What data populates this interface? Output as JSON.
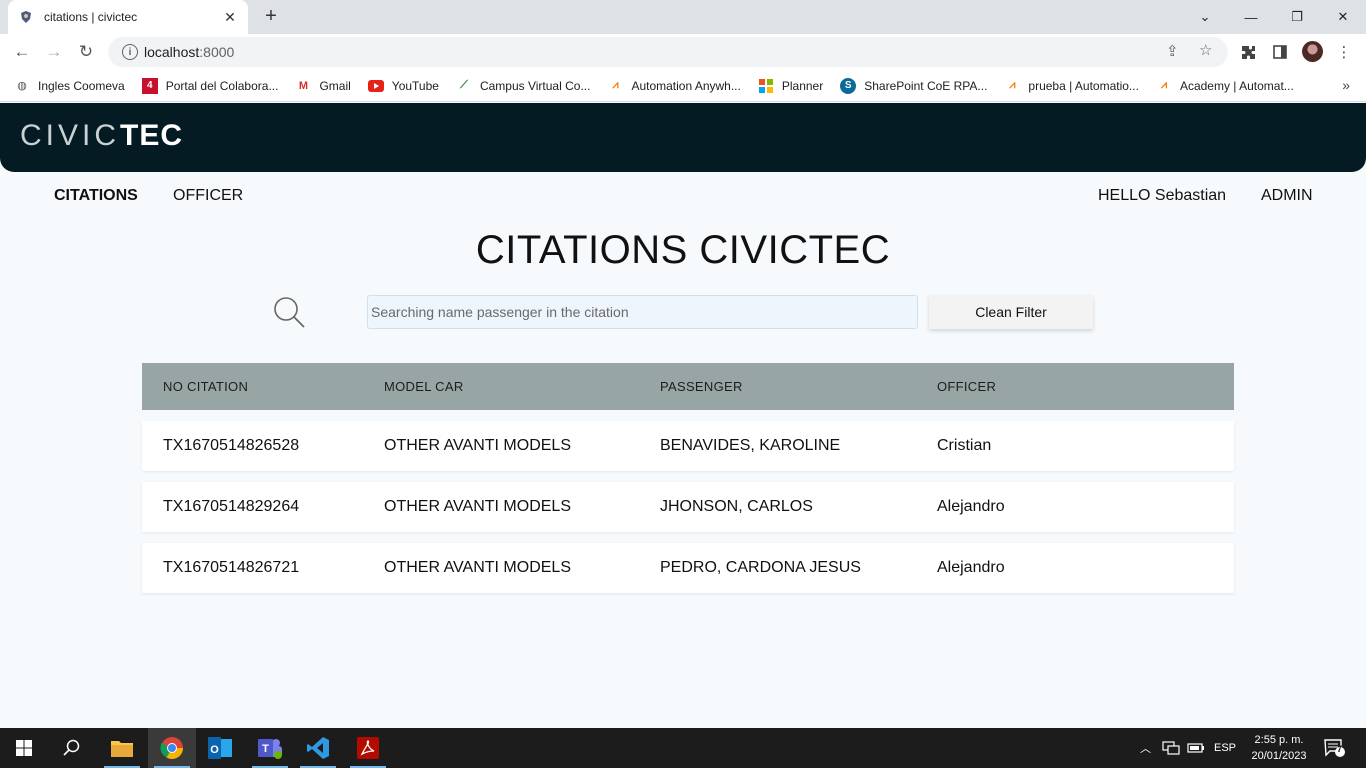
{
  "browser": {
    "tab_title": "citations | civictec",
    "url_host": "localhost",
    "url_port": ":8000",
    "bookmarks": [
      {
        "label": "Ingles Coomeva",
        "icon": "globe-icon"
      },
      {
        "label": "Portal del Colabora...",
        "icon": "portal-icon"
      },
      {
        "label": "Gmail",
        "icon": "gmail-icon"
      },
      {
        "label": "YouTube",
        "icon": "youtube-icon"
      },
      {
        "label": "Campus Virtual Co...",
        "icon": "campus-icon"
      },
      {
        "label": "Automation Anywh...",
        "icon": "automation-anywhere-icon"
      },
      {
        "label": "Planner",
        "icon": "planner-icon"
      },
      {
        "label": "SharePoint CoE RPA...",
        "icon": "sharepoint-icon"
      },
      {
        "label": "prueba | Automatio...",
        "icon": "automation-anywhere-icon"
      },
      {
        "label": "Academy | Automat...",
        "icon": "automation-anywhere-icon"
      }
    ]
  },
  "app": {
    "logo_light": "CIVIC",
    "logo_bold": "TEC",
    "nav": {
      "citations": "CITATIONS",
      "officer": "OFFICER",
      "greeting": "HELLO Sebastian",
      "admin": "ADMIN"
    },
    "title": "CITATIONS CIVICTEC",
    "search": {
      "placeholder": "Searching name passenger in the citation",
      "value": ""
    },
    "clean_button": "Clean Filter",
    "table": {
      "headers": [
        "NO CITATION",
        "MODEL CAR",
        "PASSENGER",
        "OFFICER"
      ],
      "rows": [
        [
          "TX1670514826528",
          "OTHER AVANTI MODELS",
          "BENAVIDES, KAROLINE",
          "Cristian"
        ],
        [
          "TX1670514829264",
          "OTHER AVANTI MODELS",
          "JHONSON, CARLOS",
          "Alejandro"
        ],
        [
          "TX1670514826721",
          "OTHER AVANTI MODELS",
          "PEDRO, CARDONA JESUS",
          "Alejandro"
        ]
      ]
    }
  },
  "taskbar": {
    "time": "2:55 p. m.",
    "date": "20/01/2023",
    "lang": "ESP",
    "notifications": "7"
  },
  "colors": {
    "header_bg": "#041b23",
    "table_header_bg": "#97a6a5",
    "page_bg": "#f7fafc"
  }
}
